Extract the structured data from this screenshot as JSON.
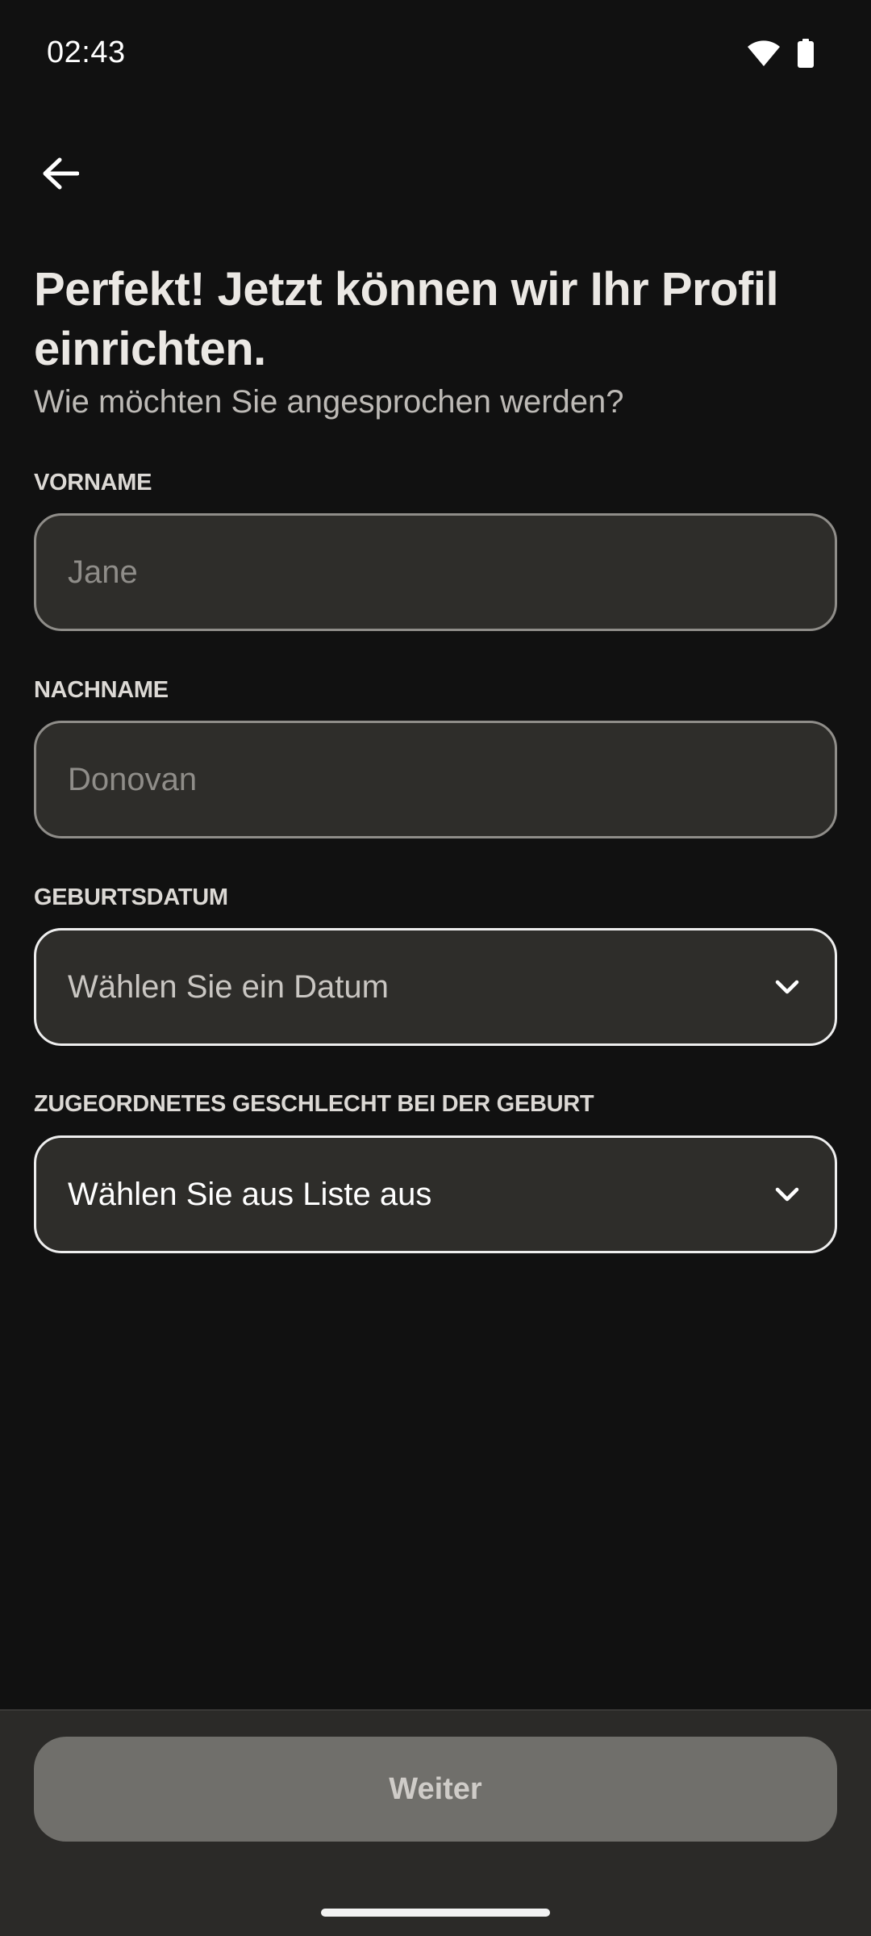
{
  "status_bar": {
    "time": "02:43",
    "icons": [
      "wifi-icon",
      "battery-icon"
    ]
  },
  "header": {
    "back_icon": "arrow-left-icon"
  },
  "main": {
    "headline": "Perfekt! Jetzt können wir Ihr Profil einrichten.",
    "subtitle": "Wie möchten Sie angesprochen werden?"
  },
  "form": {
    "first_name": {
      "label": "VORNAME",
      "placeholder": "Jane",
      "value": ""
    },
    "last_name": {
      "label": "NACHNAME",
      "placeholder": "Donovan",
      "value": ""
    },
    "birth_date": {
      "label": "GEBURTSDATUM",
      "value": "Wählen Sie ein Datum",
      "icon": "chevron-down-icon"
    },
    "sex_at_birth": {
      "label": "ZUGEORDNETES GESCHLECHT BEI DER GEBURT",
      "value": "Wählen Sie aus Liste aus",
      "icon": "chevron-down-icon"
    }
  },
  "footer": {
    "next_label": "Weiter"
  },
  "colors": {
    "background": "#111111",
    "field_background": "#2e2d2a",
    "button_disabled": "#706f6b",
    "bottom_bar": "#2b2a28"
  }
}
